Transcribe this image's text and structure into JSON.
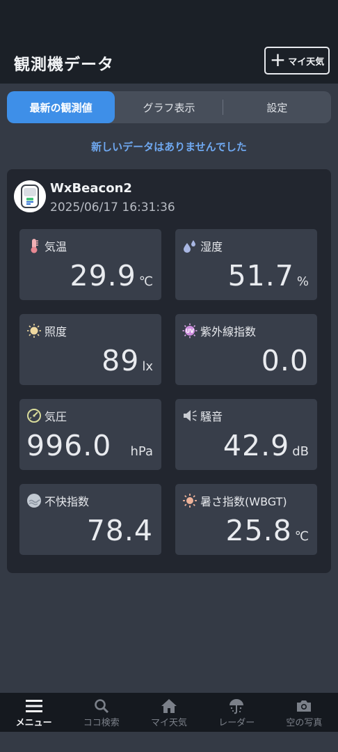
{
  "header": {
    "title": "観測機データ",
    "add_button_label": "マイ天気"
  },
  "tabs": [
    {
      "label": "最新の観測値",
      "active": true
    },
    {
      "label": "グラフ表示",
      "active": false
    },
    {
      "label": "設定",
      "active": false
    }
  ],
  "notice": "新しいデータはありませんでした",
  "device": {
    "name": "WxBeacon2",
    "timestamp": "2025/06/17 16:31:36"
  },
  "readings": {
    "temperature": {
      "label": "気温",
      "value": "29.9",
      "unit": "℃",
      "icon": "thermometer-icon"
    },
    "humidity": {
      "label": "湿度",
      "value": "51.7",
      "unit": "%",
      "icon": "droplets-icon"
    },
    "illuminance": {
      "label": "照度",
      "value": "89",
      "unit": "lx",
      "icon": "bulb-icon"
    },
    "uv": {
      "label": "紫外線指数",
      "value": "0.0",
      "unit": "",
      "icon": "uv-icon"
    },
    "pressure": {
      "label": "気圧",
      "value": "996.0",
      "unit": "hPa",
      "icon": "gauge-icon"
    },
    "noise": {
      "label": "騒音",
      "value": "42.9",
      "unit": "dB",
      "icon": "speaker-icon"
    },
    "discomfort": {
      "label": "不快指数",
      "value": "78.4",
      "unit": "",
      "icon": "discomfort-icon"
    },
    "wbgt": {
      "label": "暑さ指数(WBGT)",
      "value": "25.8",
      "unit": "℃",
      "icon": "sun-icon"
    }
  },
  "bottom_nav": [
    {
      "label": "メニュー",
      "icon": "menu-icon",
      "active": true
    },
    {
      "label": "ココ検索",
      "icon": "search-icon",
      "active": false
    },
    {
      "label": "マイ天気",
      "icon": "home-icon",
      "active": false
    },
    {
      "label": "レーダー",
      "icon": "radar-icon",
      "active": false
    },
    {
      "label": "空の写真",
      "icon": "camera-icon",
      "active": false
    }
  ],
  "colors": {
    "accent": "#3e8fe8",
    "background": "#343a45",
    "card": "#22262f",
    "tile": "#383e4a"
  }
}
